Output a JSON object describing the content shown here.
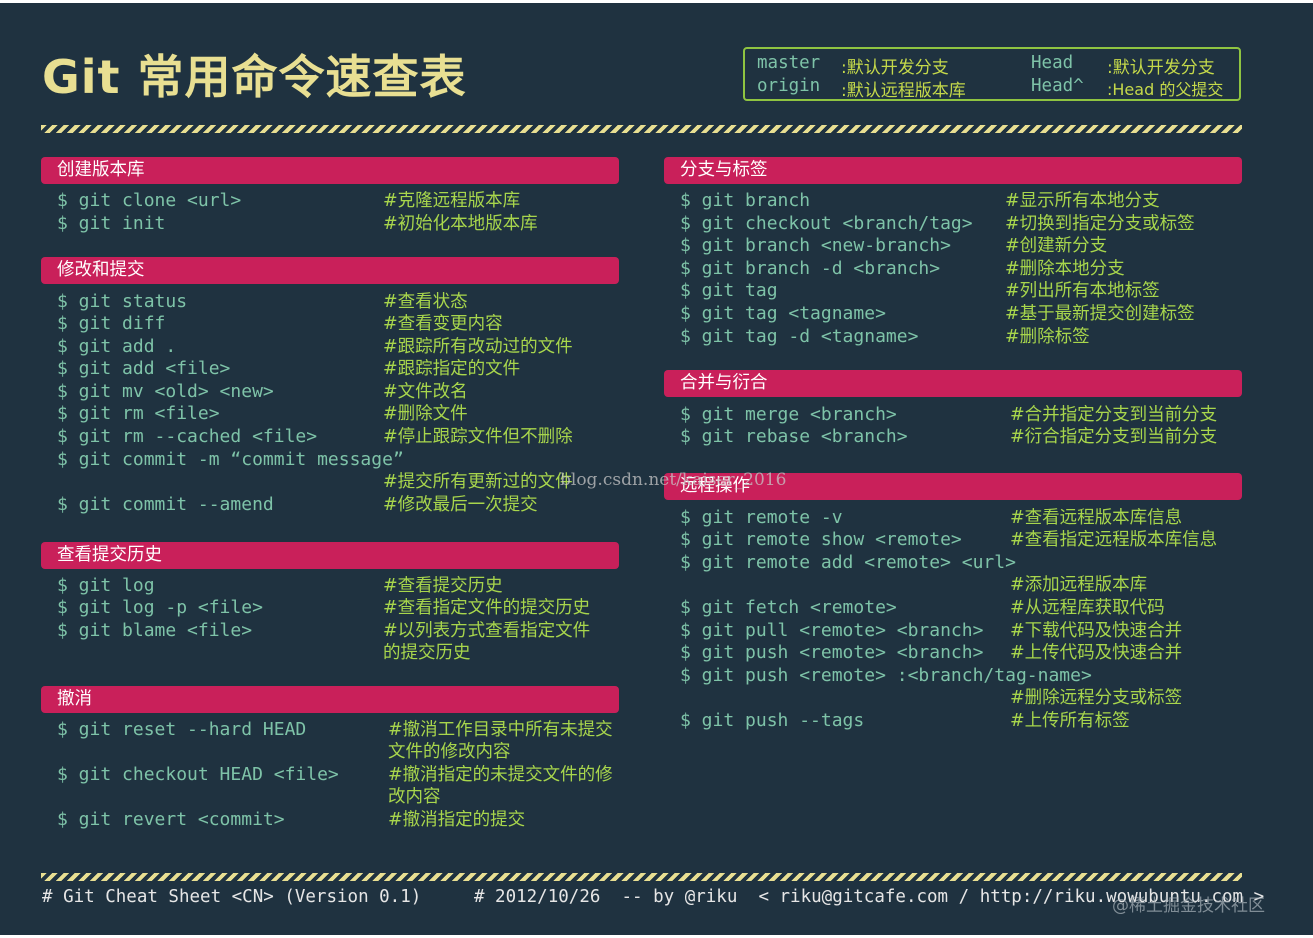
{
  "title": "Git 常用命令速查表",
  "legend": [
    {
      "key": "master",
      "desc": ":默认开发分支"
    },
    {
      "key": "origin",
      "desc": ":默认远程版本库"
    },
    {
      "key": "Head",
      "desc": ":默认开发分支"
    },
    {
      "key": "Head^",
      "desc": ":Head 的父提交"
    }
  ],
  "sections": {
    "create": {
      "title": "创建版本库",
      "commands": [
        {
          "cmd": "$ git clone <url>",
          "comment": "#克隆远程版本库"
        },
        {
          "cmd": "$ git init",
          "comment": "#初始化本地版本库"
        }
      ]
    },
    "modify": {
      "title": "修改和提交",
      "commands": [
        {
          "cmd": "$ git status",
          "comment": "#查看状态"
        },
        {
          "cmd": "$ git diff",
          "comment": "#查看变更内容"
        },
        {
          "cmd": "$ git add .",
          "comment": "#跟踪所有改动过的文件"
        },
        {
          "cmd": "$ git add <file>",
          "comment": "#跟踪指定的文件"
        },
        {
          "cmd": "$ git mv <old> <new>",
          "comment": "#文件改名"
        },
        {
          "cmd": "$ git rm <file>",
          "comment": "#删除文件"
        },
        {
          "cmd": "$ git rm --cached <file>",
          "comment": "#停止跟踪文件但不删除"
        },
        {
          "cmd": "$ git commit -m “commit message”",
          "comment": "#提交所有更新过的文件"
        },
        {
          "cmd": "$ git commit --amend",
          "comment": "#修改最后一次提交"
        }
      ]
    },
    "history": {
      "title": "查看提交历史",
      "commands": [
        {
          "cmd": "$ git log",
          "comment": "#查看提交历史"
        },
        {
          "cmd": "$ git log -p <file>",
          "comment": "#查看指定文件的提交历史"
        },
        {
          "cmd": "$ git blame <file>",
          "comment": "#以列表方式查看指定文件",
          "comment2": "的提交历史"
        }
      ]
    },
    "undo": {
      "title": "撤消",
      "commands": [
        {
          "cmd": "$ git reset --hard HEAD",
          "comment": "#撤消工作目录中所有未提交",
          "comment2": "文件的修改内容"
        },
        {
          "cmd": "$ git checkout HEAD <file>",
          "comment": "#撤消指定的未提交文件的修",
          "comment2": "改内容"
        },
        {
          "cmd": "$ git revert <commit>",
          "comment": "#撤消指定的提交"
        }
      ]
    },
    "branch": {
      "title": "分支与标签",
      "commands": [
        {
          "cmd": "$ git branch",
          "comment": "#显示所有本地分支"
        },
        {
          "cmd": "$ git checkout <branch/tag>",
          "comment": "#切换到指定分支或标签"
        },
        {
          "cmd": "$ git branch <new-branch>",
          "comment": "#创建新分支"
        },
        {
          "cmd": "$ git branch -d <branch>",
          "comment": "#删除本地分支"
        },
        {
          "cmd": "$ git tag",
          "comment": "#列出所有本地标签"
        },
        {
          "cmd": "$ git tag <tagname>",
          "comment": "#基于最新提交创建标签"
        },
        {
          "cmd": "$ git tag -d <tagname>",
          "comment": "#删除标签"
        }
      ]
    },
    "merge": {
      "title": "合并与衍合",
      "commands": [
        {
          "cmd": "$ git merge <branch>",
          "comment": "#合并指定分支到当前分支"
        },
        {
          "cmd": "$ git rebase <branch>",
          "comment": "#衍合指定分支到当前分支"
        }
      ]
    },
    "remote": {
      "title": "远程操作",
      "commands": [
        {
          "cmd": "$ git remote -v",
          "comment": "#查看远程版本库信息"
        },
        {
          "cmd": "$ git remote show <remote>",
          "comment": "#查看指定远程版本库信息"
        },
        {
          "cmd": "$ git remote add <remote> <url>",
          "comment": "#添加远程版本库"
        },
        {
          "cmd": "$ git fetch <remote>",
          "comment": "#从远程库获取代码"
        },
        {
          "cmd": "$ git pull <remote> <branch>",
          "comment": "#下载代码及快速合并"
        },
        {
          "cmd": "$ git push <remote> <branch>",
          "comment": "#上传代码及快速合并"
        },
        {
          "cmd": "$ git push <remote> :<branch/tag-name>",
          "comment": "#删除远程分支或标签"
        },
        {
          "cmd": "$ git push --tags",
          "comment": "#上传所有标签"
        }
      ]
    }
  },
  "watermark": "blog.csdn.net/kaiser_2016",
  "footer": "# Git Cheat Sheet <CN> (Version 0.1)     # 2012/10/26  -- by @riku  < riku@gitcafe.com / http://riku.wowubuntu.com >",
  "corner_mark": "@稀土掘金技术社区",
  "colors": {
    "background": "#1f3240",
    "title": "#e8df92",
    "section_header": "#c9205a",
    "command": "#7ec3a8",
    "comment": "#a8d64c",
    "legend_border": "#8fc441"
  }
}
